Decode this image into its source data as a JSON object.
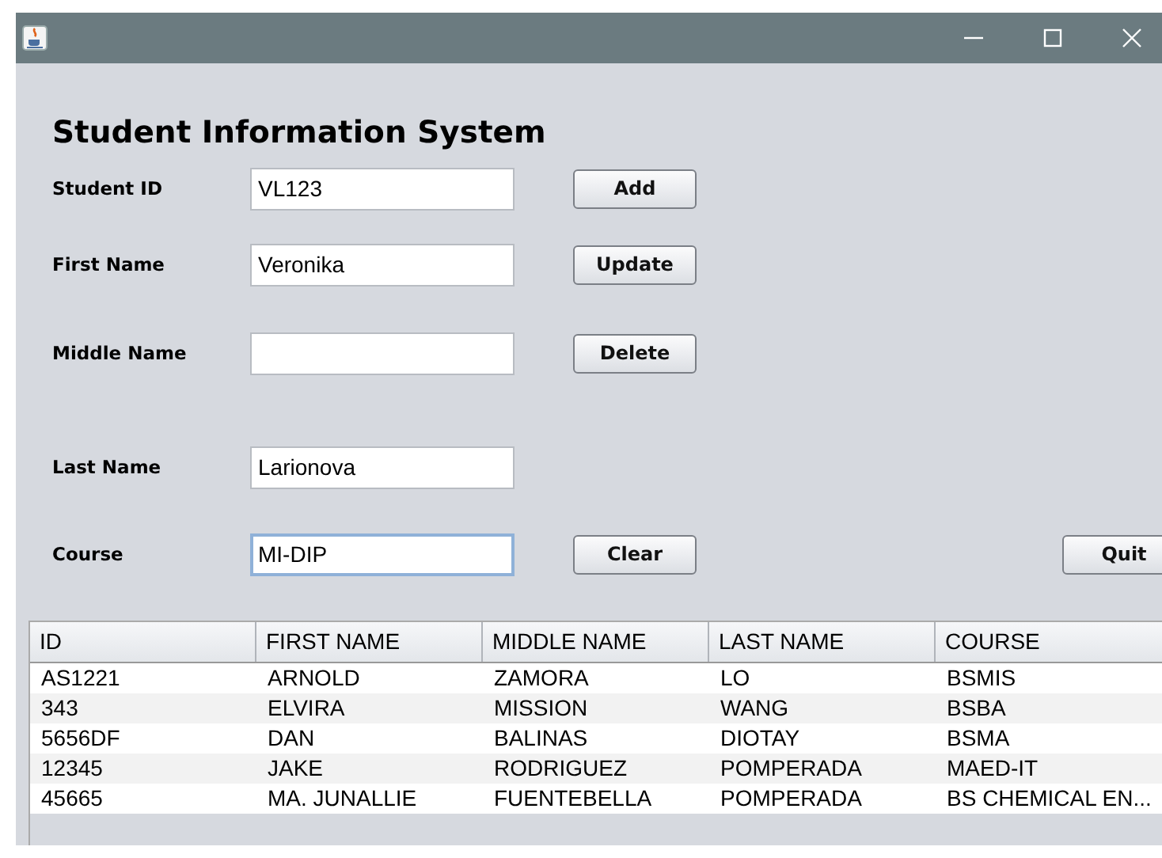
{
  "window": {
    "controls": [
      {
        "kind": "minimize"
      },
      {
        "kind": "maximize"
      },
      {
        "kind": "close"
      }
    ]
  },
  "form": {
    "title": "Student Information System",
    "rows": [
      {
        "label": "Student ID",
        "value": "VL123",
        "focused": false,
        "button": "Add"
      },
      {
        "label": "First Name",
        "value": "Veronika",
        "focused": false,
        "button": "Update"
      },
      {
        "label": "Middle Name",
        "value": "",
        "focused": false,
        "button": "Delete"
      },
      {
        "label": "Last Name",
        "value": "Larionova",
        "focused": false
      },
      {
        "label": "Course",
        "value": "MI-DIP",
        "focused": true,
        "button": "Clear"
      }
    ],
    "quit_button": "Quit"
  },
  "table": {
    "columns": [
      "ID",
      "FIRST NAME",
      "MIDDLE NAME",
      "LAST NAME",
      "COURSE"
    ],
    "rows": [
      [
        "AS1221",
        "ARNOLD",
        "ZAMORA",
        "LO",
        "BSMIS"
      ],
      [
        "343",
        "ELVIRA",
        "MISSION",
        "WANG",
        "BSBA"
      ],
      [
        "5656DF",
        "DAN",
        "BALINAS",
        "DIOTAY",
        "BSMA"
      ],
      [
        "12345",
        "JAKE",
        "RODRIGUEZ",
        "POMPERADA",
        "MAED-IT"
      ],
      [
        "45665",
        "MA. JUNALLIE",
        "FUENTEBELLA",
        "POMPERADA",
        "BS CHEMICAL EN..."
      ]
    ]
  }
}
